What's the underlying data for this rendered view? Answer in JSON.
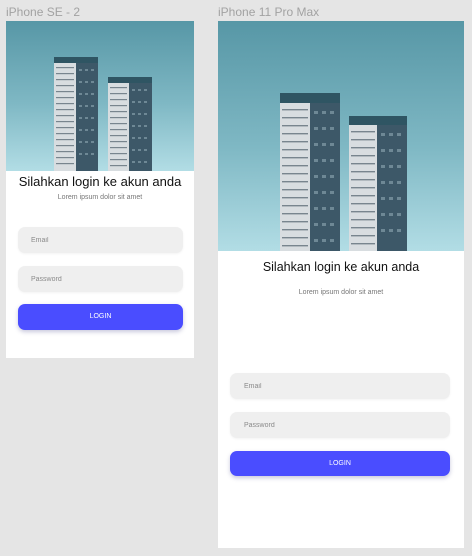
{
  "frames": [
    {
      "device_label": "iPhone SE - 2",
      "hero_image": "city-skyscrapers-photo",
      "title": "Silahkan login ke akun anda",
      "subtitle": "Lorem ipsum dolor sit amet",
      "email_placeholder": "Email",
      "password_placeholder": "Password",
      "login_label": "LOGIN"
    },
    {
      "device_label": "iPhone 11 Pro Max",
      "hero_image": "city-skyscrapers-photo",
      "title": "Silahkan login ke akun anda",
      "subtitle": "Lorem ipsum dolor sit amet",
      "email_placeholder": "Email",
      "password_placeholder": "Password",
      "login_label": "LOGIN"
    }
  ],
  "colors": {
    "canvas_background": "#e5e5e5",
    "frame_background": "#ffffff",
    "sky_top": "#5797a6",
    "sky_bottom": "#b2dde5",
    "input_background": "#efefef",
    "button_background": "#4a4dff",
    "button_text": "#ffffff",
    "label_text": "#a2a2a2"
  }
}
